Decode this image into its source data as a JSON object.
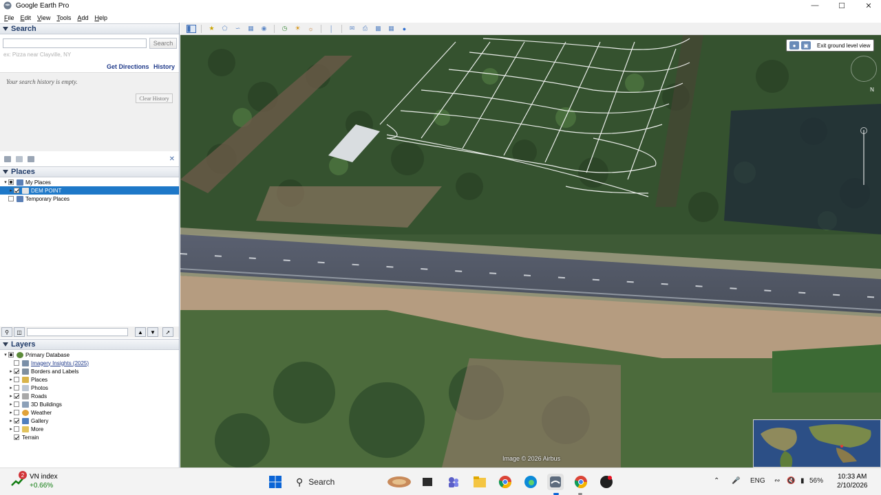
{
  "window": {
    "title": "Google Earth Pro"
  },
  "menu": [
    "File",
    "Edit",
    "View",
    "Tools",
    "Add",
    "Help"
  ],
  "search_panel": {
    "header": "Search",
    "input_value": "",
    "button": "Search",
    "hint": "ex: Pizza near Clayville, NY",
    "get_directions": "Get Directions",
    "history": "History",
    "empty_history": "Your search history is empty.",
    "clear_history": "Clear History"
  },
  "places_panel": {
    "header": "Places",
    "items": [
      {
        "label": "My Places",
        "checked": "partial",
        "expanded": true
      },
      {
        "label": "DEM POINT",
        "checked": true,
        "selected": true
      },
      {
        "label": "Temporary Places",
        "checked": false
      }
    ]
  },
  "layers_panel": {
    "header": "Layers",
    "items": [
      {
        "label": "Primary Database",
        "checked": "partial",
        "icon": "globe-icon"
      },
      {
        "label": "Imagery Insights (2025)",
        "checked": false,
        "link": true,
        "icon": "layers-icon"
      },
      {
        "label": "Borders and Labels",
        "checked": true,
        "icon": "flag-icon"
      },
      {
        "label": "Places",
        "checked": false,
        "icon": "places-icon"
      },
      {
        "label": "Photos",
        "checked": false,
        "icon": "photo-icon"
      },
      {
        "label": "Roads",
        "checked": true,
        "icon": "roads-icon"
      },
      {
        "label": "3D Buildings",
        "checked": false,
        "icon": "buildings-icon"
      },
      {
        "label": "Weather",
        "checked": false,
        "icon": "weather-icon"
      },
      {
        "label": "Gallery",
        "checked": true,
        "icon": "gallery-icon"
      },
      {
        "label": "More",
        "checked": false,
        "icon": "folder-icon"
      },
      {
        "label": "Terrain",
        "checked": true,
        "icon": ""
      }
    ]
  },
  "view": {
    "exit_ground_label": "Exit ground level view",
    "copyright": "Image © 2026 Airbus",
    "compass_north": "N"
  },
  "taskbar": {
    "weather_title": "VN index",
    "weather_value": "+0.66%",
    "weather_badge": "2",
    "search_label": "Search",
    "language": "ENG",
    "battery": "56%",
    "time": "10:33 AM",
    "date": "2/10/2026"
  },
  "colors": {
    "accent_selected": "#1e78c8",
    "header_text": "#1f3a68",
    "link_blue": "#1f3a8a"
  }
}
